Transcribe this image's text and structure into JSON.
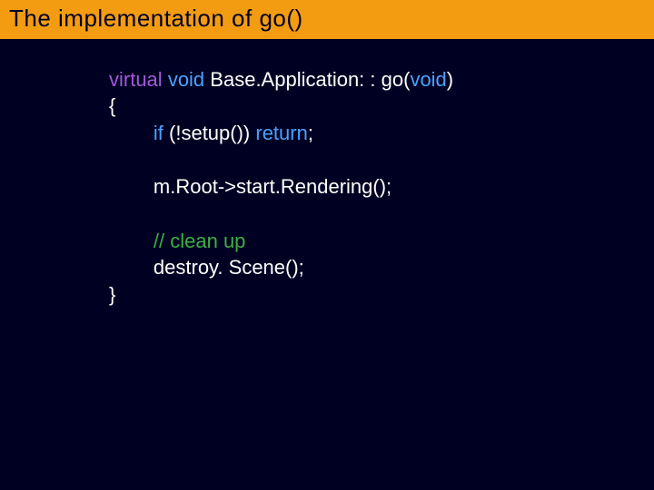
{
  "slide": {
    "title": "The implementation of go()"
  },
  "code": {
    "virtual": "virtual",
    "void1": "void",
    "classAndMethod": "Base.Application: : go(",
    "void2": "void",
    "declClose": ")",
    "braceOpen": "{",
    "if": "if",
    "cond": " (!setup()) ",
    "return": "return",
    "semi1": ";",
    "line2": "m.Root->start.Rendering();",
    "commentLine": "// clean up",
    "line3": "destroy. Scene();",
    "braceClose": "}"
  }
}
